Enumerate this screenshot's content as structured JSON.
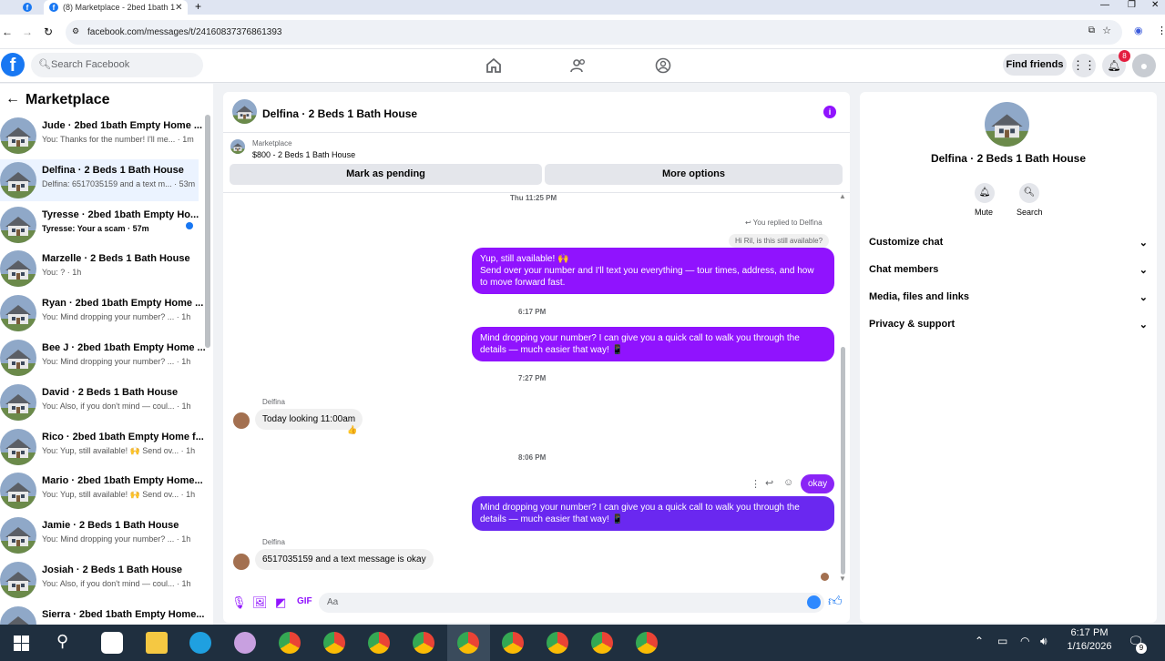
{
  "browser": {
    "tab_title": "(8) Marketplace - 2bed 1bath 1",
    "url": "facebook.com/messages/t/24160837376861393"
  },
  "fb_header": {
    "search_placeholder": "Search Facebook",
    "find_friends": "Find friends",
    "notif_badge": "8"
  },
  "left": {
    "title": "Marketplace",
    "conversations": [
      {
        "name": "Jude · 2bed 1bath Empty Home ...",
        "preview": "You: Thanks for the number! I'll me...",
        "time": "1m",
        "selected": false,
        "unread": false
      },
      {
        "name": "Delfina · 2 Beds 1 Bath House",
        "preview": "Delfina: 6517035159 and a text m...",
        "time": "53m",
        "selected": true,
        "unread": false
      },
      {
        "name": "Tyresse · 2bed 1bath Empty Ho...",
        "preview": "Tyresse: Your a scam",
        "time": "57m",
        "selected": false,
        "unread": true
      },
      {
        "name": "Marzelle · 2 Beds 1 Bath House",
        "preview": "You: ?",
        "time": "1h",
        "selected": false,
        "unread": false
      },
      {
        "name": "Ryan · 2bed 1bath Empty Home ...",
        "preview": "You: Mind dropping your number? ...",
        "time": "1h",
        "selected": false,
        "unread": false
      },
      {
        "name": "Bee J · 2bed 1bath Empty Home ...",
        "preview": "You: Mind dropping your number? ...",
        "time": "1h",
        "selected": false,
        "unread": false
      },
      {
        "name": "David · 2 Beds 1 Bath House",
        "preview": "You: Also, if you don't mind — coul...",
        "time": "1h",
        "selected": false,
        "unread": false
      },
      {
        "name": "Rico · 2bed 1bath Empty Home f...",
        "preview": "You: Yup, still available! 🙌 Send ov...",
        "time": "1h",
        "selected": false,
        "unread": false
      },
      {
        "name": "Mario · 2bed 1bath Empty Home...",
        "preview": "You: Yup, still available! 🙌 Send ov...",
        "time": "1h",
        "selected": false,
        "unread": false
      },
      {
        "name": "Jamie · 2 Beds 1 Bath House",
        "preview": "You: Mind dropping your number? ...",
        "time": "1h",
        "selected": false,
        "unread": false
      },
      {
        "name": "Josiah · 2 Beds 1 Bath House",
        "preview": "You: Also, if you don't mind — coul...",
        "time": "1h",
        "selected": false,
        "unread": false
      },
      {
        "name": "Sierra · 2bed 1bath Empty Home...",
        "preview": "",
        "time": "",
        "selected": false,
        "unread": false
      }
    ]
  },
  "chat": {
    "title": "Delfina · 2 Beds 1 Bath House",
    "listing_label": "Marketplace",
    "listing_detail": "$800 - 2 Beds 1 Bath House",
    "mark_pending": "Mark as pending",
    "more_options": "More options",
    "time1": "Thu 11:25 PM",
    "replied_to": "You replied to Delfina",
    "quoted": "Hi Ril, is this still available?",
    "msg1_line1": "Yup, still available! 🙌",
    "msg1_line2": "Send over your number and I'll text you everything — tour times, address, and how",
    "msg1_line3": "to move forward fast.",
    "time2": "6:17 PM",
    "msg2_line1": "Mind dropping your number? I can give you a quick call to walk you through the",
    "msg2_line2": "details — much easier that way! 📱",
    "time3": "7:27 PM",
    "sender1": "Delfina",
    "in1": "Today looking 11:00am",
    "in1_reaction": "👍",
    "time4": "8:06 PM",
    "msg3": "okay",
    "msg4_line1": "Mind dropping your number? I can give you a quick call to walk you through the",
    "msg4_line2": "details — much easier that way! 📱",
    "sender2": "Delfina",
    "in2": "6517035159 and a text message is okay",
    "composer_placeholder": "Aa"
  },
  "right": {
    "title": "Delfina · 2 Beds 1 Bath House",
    "mute": "Mute",
    "search": "Search",
    "sections": [
      "Customize chat",
      "Chat members",
      "Media, files and links",
      "Privacy & support"
    ]
  },
  "taskbar": {
    "time": "6:17 PM",
    "date": "1/16/2026",
    "notif_count": "9"
  },
  "colors": {
    "accent": "#9013fe",
    "fb_blue": "#1877f2",
    "badge_red": "#e41e3f"
  }
}
